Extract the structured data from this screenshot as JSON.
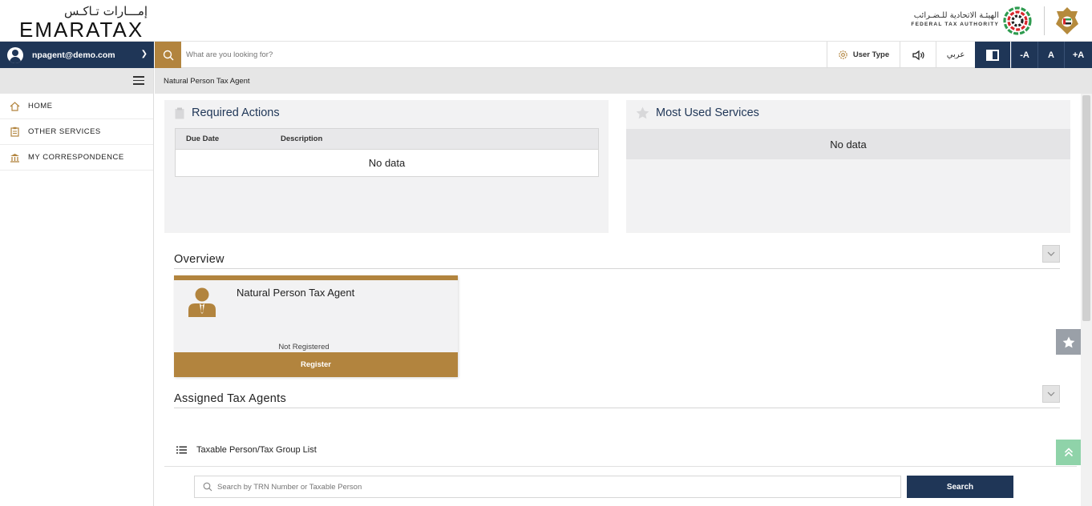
{
  "brand": {
    "logo_arabic": "إمـــارات تـاكـس",
    "logo_english": "EMARATAX",
    "fta_arabic": "الهيئـة الاتحادية للـضـرائب",
    "fta_english": "FEDERAL TAX AUTHORITY"
  },
  "toolbar": {
    "user_email": "npagent@demo.com",
    "search_placeholder": "What are you looking for?",
    "user_type_label": "User Type",
    "language_label": "عربي",
    "font_decrease": "-A",
    "font_normal": "A",
    "font_increase": "+A"
  },
  "sidebar": {
    "items": [
      {
        "label": "HOME",
        "icon": "home-icon"
      },
      {
        "label": "OTHER SERVICES",
        "icon": "clipboard-icon"
      },
      {
        "label": "MY CORRESPONDENCE",
        "icon": "building-icon"
      }
    ]
  },
  "breadcrumb": "Natural Person Tax Agent",
  "required_actions": {
    "title": "Required Actions",
    "columns": [
      "Due Date",
      "Description"
    ],
    "empty_text": "No data"
  },
  "most_used": {
    "title": "Most Used Services",
    "empty_text": "No data"
  },
  "overview": {
    "title": "Overview",
    "card": {
      "title": "Natural Person Tax Agent",
      "status": "Not Registered",
      "action_label": "Register"
    }
  },
  "assigned": {
    "title": "Assigned Tax Agents",
    "list_label": "Taxable Person/Tax Group List",
    "search_placeholder": "Search by TRN Number or Taxable Person",
    "search_button": "Search"
  },
  "colors": {
    "navy": "#1f3657",
    "gold": "#b2843e",
    "panel": "#f2f2f3"
  }
}
